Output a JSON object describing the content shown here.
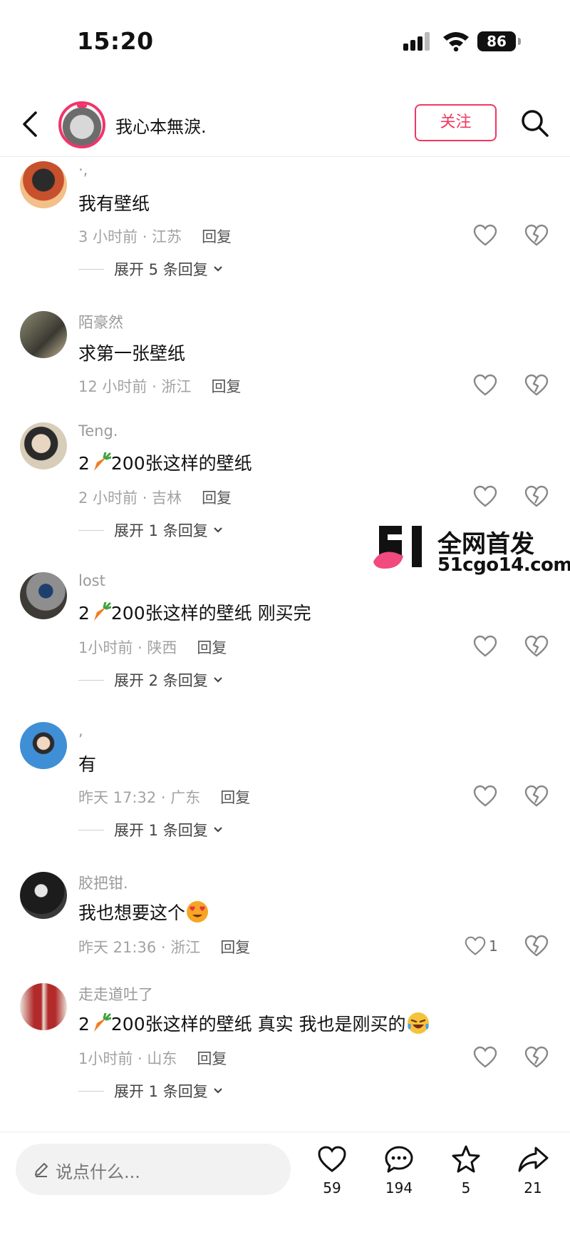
{
  "status_bar": {
    "time": "15:20",
    "battery": "86"
  },
  "header": {
    "back_icon": "chevron-left-icon",
    "name": "我心本無淚.",
    "follow_label": "关注",
    "search_icon": "search-icon"
  },
  "comments": [
    {
      "username": "·,",
      "text": "我有壁纸",
      "time_location": "3 小时前 · 江苏",
      "reply_label": "回复",
      "likes": "",
      "expand_label": "展开 5 条回复"
    },
    {
      "username": "陌豪然",
      "text": "求第一张壁纸",
      "time_location": "12 小时前 · 浙江",
      "reply_label": "回复",
      "likes": "",
      "expand_label": ""
    },
    {
      "username": "Teng.",
      "text_prefix": "2",
      "text_suffix": "200张这样的壁纸",
      "time_location": "2 小时前 · 吉林",
      "reply_label": "回复",
      "likes": "",
      "expand_label": "展开 1 条回复"
    },
    {
      "username": "lost",
      "text_prefix": "2",
      "text_suffix": "200张这样的壁纸 刚买完",
      "time_location": "1小时前 · 陕西",
      "reply_label": "回复",
      "likes": "",
      "expand_label": "展开 2 条回复"
    },
    {
      "username": ",",
      "text": "有",
      "time_location": "昨天 17:32 · 广东",
      "reply_label": "回复",
      "likes": "",
      "expand_label": "展开 1 条回复"
    },
    {
      "username": "胶把钳.",
      "text": "我也想要这个",
      "time_location": "昨天 21:36 · 浙江",
      "reply_label": "回复",
      "likes": "1",
      "expand_label": ""
    },
    {
      "username": "走走道吐了",
      "text_prefix": "2",
      "text_suffix": "200张这样的壁纸 真实 我也是刚买的",
      "time_location": "1小时前 · 山东",
      "reply_label": "回复",
      "likes": "",
      "expand_label": "展开 1 条回复"
    }
  ],
  "watermark": {
    "title": "全网首发",
    "url": "51cgo14.com"
  },
  "bottom_bar": {
    "input_placeholder": "说点什么...",
    "likes": "59",
    "comments": "194",
    "favorites": "5",
    "shares": "21"
  },
  "colors": {
    "accent": "#f0385f",
    "muted": "#a3a3a3"
  }
}
